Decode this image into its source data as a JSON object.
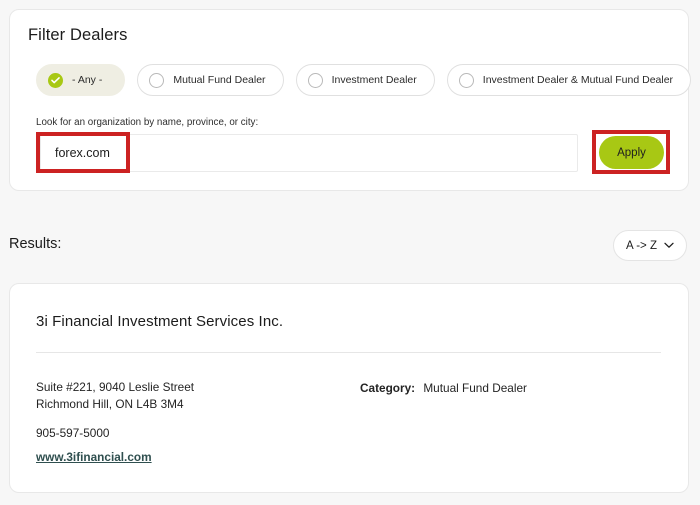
{
  "filter_panel": {
    "title": "Filter Dealers",
    "chips": [
      {
        "label": "- Any -",
        "selected": true,
        "icon": "check-icon"
      },
      {
        "label": "Mutual Fund Dealer",
        "selected": false,
        "icon": "radio-icon"
      },
      {
        "label": "Investment Dealer",
        "selected": false,
        "icon": "radio-icon"
      },
      {
        "label": "Investment Dealer & Mutual Fund Dealer",
        "selected": false,
        "icon": "radio-icon"
      }
    ],
    "search": {
      "label": "Look for an organization by name, province, or city:",
      "value": "forex.com",
      "placeholder": ""
    },
    "apply_label": "Apply"
  },
  "results_bar": {
    "label": "Results:",
    "sort": {
      "value": "A -> Z",
      "icon": "chevron-down-icon"
    }
  },
  "result": {
    "org_name": "3i Financial Investment Services Inc.",
    "address_line1": "Suite #221, 9040 Leslie Street",
    "address_line2": "Richmond Hill, ON L4B 3M4",
    "phone": "905-597-5000",
    "website": "www.3ifinancial.com",
    "category_key": "Category:",
    "category_value": "Mutual Fund Dealer"
  },
  "colors": {
    "accent_green": "#a8c814",
    "chip_selected_bg": "#efeee3",
    "annotation_red": "#cc2222",
    "link": "#2f4f4f",
    "page_bg": "#f7f7f7"
  }
}
